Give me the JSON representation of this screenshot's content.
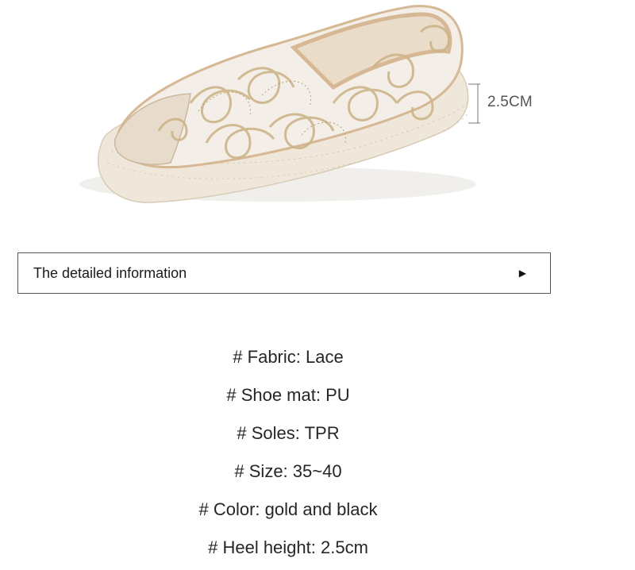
{
  "measurement": {
    "label": "2.5CM"
  },
  "info_bar": {
    "title": "The detailed information",
    "arrow_icon": "triangle-right-icon"
  },
  "specs": [
    "# Fabric: Lace",
    "# Shoe mat: PU",
    "# Soles: TPR",
    "# Size: 35~40",
    "# Color: gold and black",
    "# Heel height: 2.5cm"
  ],
  "colors": {
    "sole": "#eee6d8",
    "lace": "#cdb588",
    "trim": "#d6b994",
    "border": "#555555"
  }
}
